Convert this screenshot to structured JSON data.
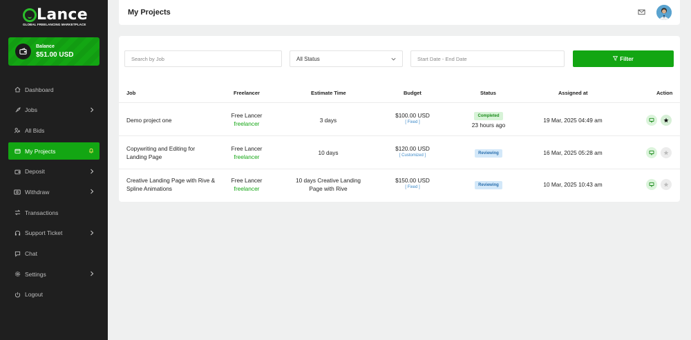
{
  "brand": {
    "logo_text": "Lance",
    "tagline": "GLOBAL FREELANCING MARKETPLACE",
    "accent_color": "#13a613"
  },
  "balance": {
    "label": "Balance",
    "value": "$51.00 USD"
  },
  "sidebar": {
    "items": [
      {
        "label": "Dashboard",
        "icon": "home-icon",
        "has_chevron": false,
        "active": false
      },
      {
        "label": "Jobs",
        "icon": "rocket-icon",
        "has_chevron": true,
        "active": false
      },
      {
        "label": "All Bids",
        "icon": "users-icon",
        "has_chevron": false,
        "active": false
      },
      {
        "label": "My Projects",
        "icon": "folder-icon",
        "has_chevron": false,
        "active": true
      },
      {
        "label": "Deposit",
        "icon": "wallet-icon",
        "has_chevron": true,
        "active": false
      },
      {
        "label": "Withdraw",
        "icon": "cash-icon",
        "has_chevron": true,
        "active": false
      },
      {
        "label": "Transactions",
        "icon": "exchange-icon",
        "has_chevron": false,
        "active": false
      },
      {
        "label": "Support Ticket",
        "icon": "headset-icon",
        "has_chevron": true,
        "active": false
      },
      {
        "label": "Chat",
        "icon": "chat-icon",
        "has_chevron": false,
        "active": false
      },
      {
        "label": "Settings",
        "icon": "gear-icon",
        "has_chevron": true,
        "active": false
      },
      {
        "label": "Logout",
        "icon": "logout-icon",
        "has_chevron": false,
        "active": false
      }
    ]
  },
  "header": {
    "title": "My Projects"
  },
  "filters": {
    "search_placeholder": "Search by Job",
    "status_value": "All Status",
    "date_placeholder": "Start Date - End Date",
    "filter_label": "Filter"
  },
  "table": {
    "columns": [
      "Job",
      "Freelancer",
      "Estimate Time",
      "Budget",
      "Status",
      "Assigned at",
      "Action"
    ],
    "rows": [
      {
        "job": "Demo project one",
        "freelancer_name": "Free Lancer",
        "freelancer_username": "freelancer",
        "estimate": "3 days",
        "budget": "$100.00 USD",
        "budget_type": "[ Fixed ]",
        "status": "Completed",
        "status_sub": "23 hours ago",
        "assigned": "19 Mar, 2025 04:49 am",
        "rated": true
      },
      {
        "job": "Copywriting and Editing for Landing Page",
        "freelancer_name": "Free Lancer",
        "freelancer_username": "freelancer",
        "estimate": "10 days",
        "budget": "$120.00 USD",
        "budget_type": "[ Customized ]",
        "status": "Reviewing",
        "status_sub": "",
        "assigned": "16 Mar, 2025 05:28 am",
        "rated": false
      },
      {
        "job": "Creative Landing Page with Rive & Spline Animations",
        "freelancer_name": "Free Lancer",
        "freelancer_username": "freelancer",
        "estimate": "10 days Creative Landing Page with Rive",
        "budget": "$150.00 USD",
        "budget_type": "[ Fixed ]",
        "status": "Reviewing",
        "status_sub": "",
        "assigned": "10 Mar, 2025 10:43 am",
        "rated": false
      }
    ]
  }
}
